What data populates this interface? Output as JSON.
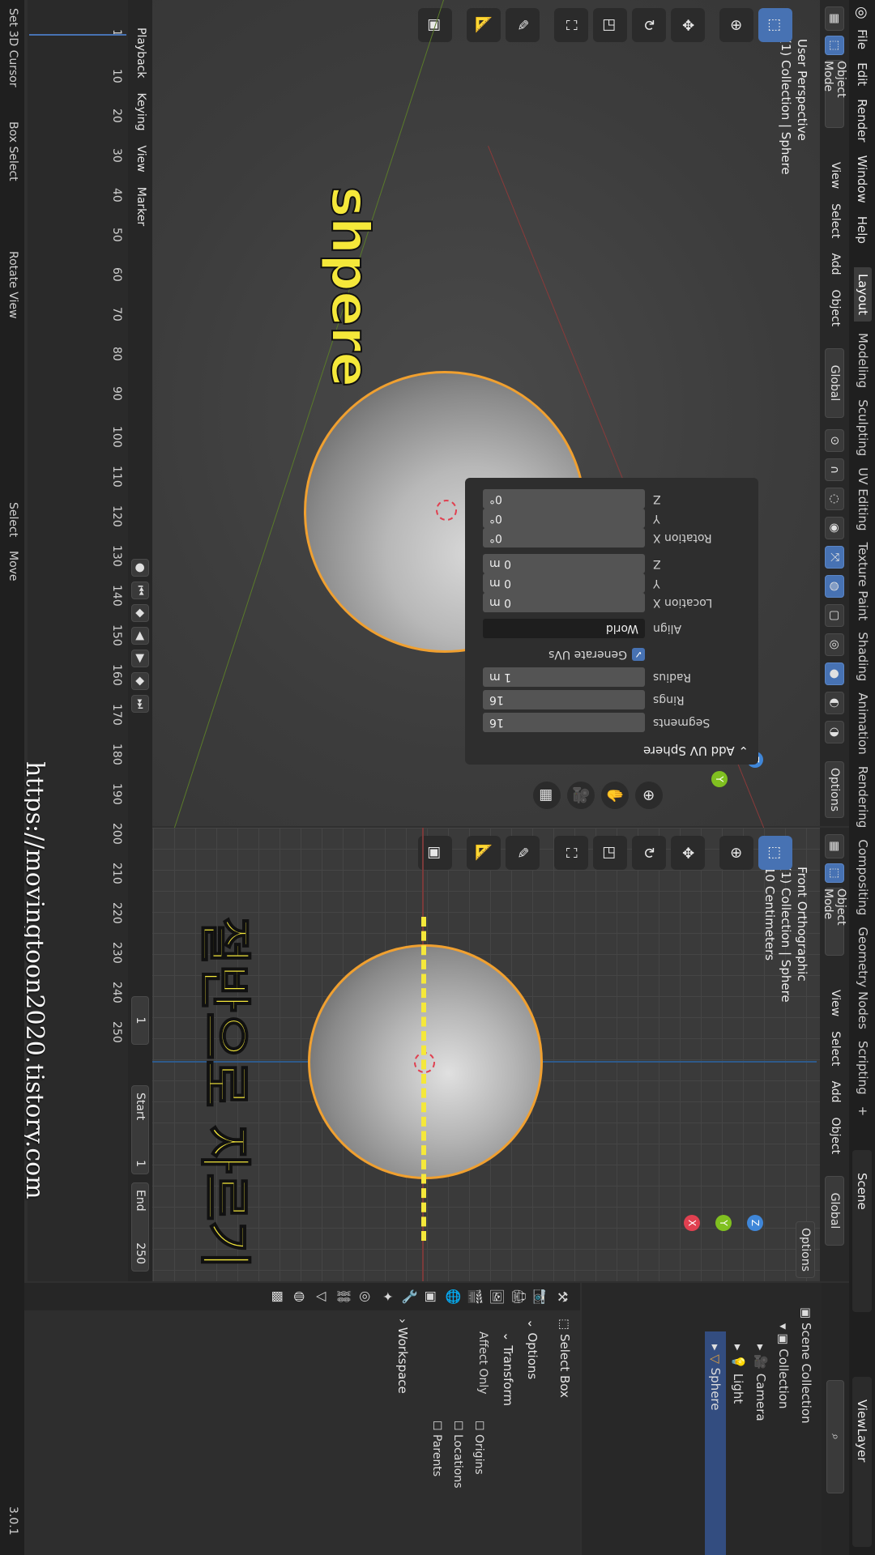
{
  "menu": [
    "File",
    "Edit",
    "Render",
    "Window",
    "Help"
  ],
  "workspaces": [
    "Layout",
    "Modeling",
    "Sculpting",
    "UV Editing",
    "Texture Paint",
    "Shading",
    "Animation",
    "Rendering",
    "Compositing",
    "Geometry Nodes",
    "Scripting"
  ],
  "workspace_add": "+",
  "scene": "Scene",
  "view_layer": "ViewLayer",
  "viewport_left": {
    "mode": "Object Mode",
    "menus": [
      "View",
      "Select",
      "Add",
      "Object"
    ],
    "orientation": "Global",
    "options": "Options",
    "info_line1": "User Perspective",
    "info_line2": "(1) Collection | Sphere",
    "caption": "shpere",
    "badge": "1"
  },
  "operator_panel": {
    "title": "Add UV Sphere",
    "segments_label": "Segments",
    "segments": "16",
    "rings_label": "Rings",
    "rings": "16",
    "radius_label": "Radius",
    "radius": "1 m",
    "gen_uvs": "Generate UVs",
    "align_label": "Align",
    "align": "World",
    "loc_label": "Location X",
    "loc_x": "0 m",
    "loc_y": "0 m",
    "loc_z": "0 m",
    "rot_label": "Rotation X",
    "rot_x": "0°",
    "rot_y": "0°",
    "rot_z": "0°",
    "y": "Y",
    "z": "Z"
  },
  "viewport_right": {
    "mode": "Object Mode",
    "menus": [
      "View",
      "Select",
      "Add",
      "Object"
    ],
    "orientation": "Global",
    "options": "Options",
    "info_line1": "Front Orthographic",
    "info_line2": "(1) Collection | Sphere",
    "info_line3": "10 Centimeters",
    "caption": "절반으로 자르기"
  },
  "gizmo": {
    "x": "X",
    "y": "Y",
    "z": "Z"
  },
  "timeline": {
    "playback": "Playback",
    "keying": "Keying",
    "view": "View",
    "marker": "Marker",
    "current_frame": "1",
    "start_label": "Start",
    "start": "1",
    "end_label": "End",
    "end": "250",
    "ticks": [
      "1",
      "10",
      "20",
      "30",
      "40",
      "50",
      "60",
      "70",
      "80",
      "90",
      "100",
      "110",
      "120",
      "130",
      "140",
      "150",
      "160",
      "170",
      "180",
      "190",
      "200",
      "210",
      "220",
      "230",
      "240",
      "250"
    ]
  },
  "status": {
    "set_cursor": "Set 3D Cursor",
    "box_select": "Box Select",
    "rotate_view": "Rotate View",
    "select": "Select",
    "move": "Move",
    "version": "3.0.1"
  },
  "watermark": "https://movingtoon2020.tistory.com",
  "outliner": {
    "root": "Scene Collection",
    "items": [
      "Collection",
      "Camera",
      "Light",
      "Sphere"
    ]
  },
  "properties": {
    "tool": "Select Box",
    "options": "Options",
    "transform": "Transform",
    "affect_only": "Affect Only",
    "origins": "Origins",
    "locations": "Locations",
    "parents": "Parents",
    "workspace": "Workspace"
  },
  "colors": {
    "accent": "#4772b3",
    "selection": "#f0a030",
    "caption": "#f5e83a",
    "axis_x": "#e04050",
    "axis_y": "#80c020",
    "axis_z": "#3f86d8"
  }
}
